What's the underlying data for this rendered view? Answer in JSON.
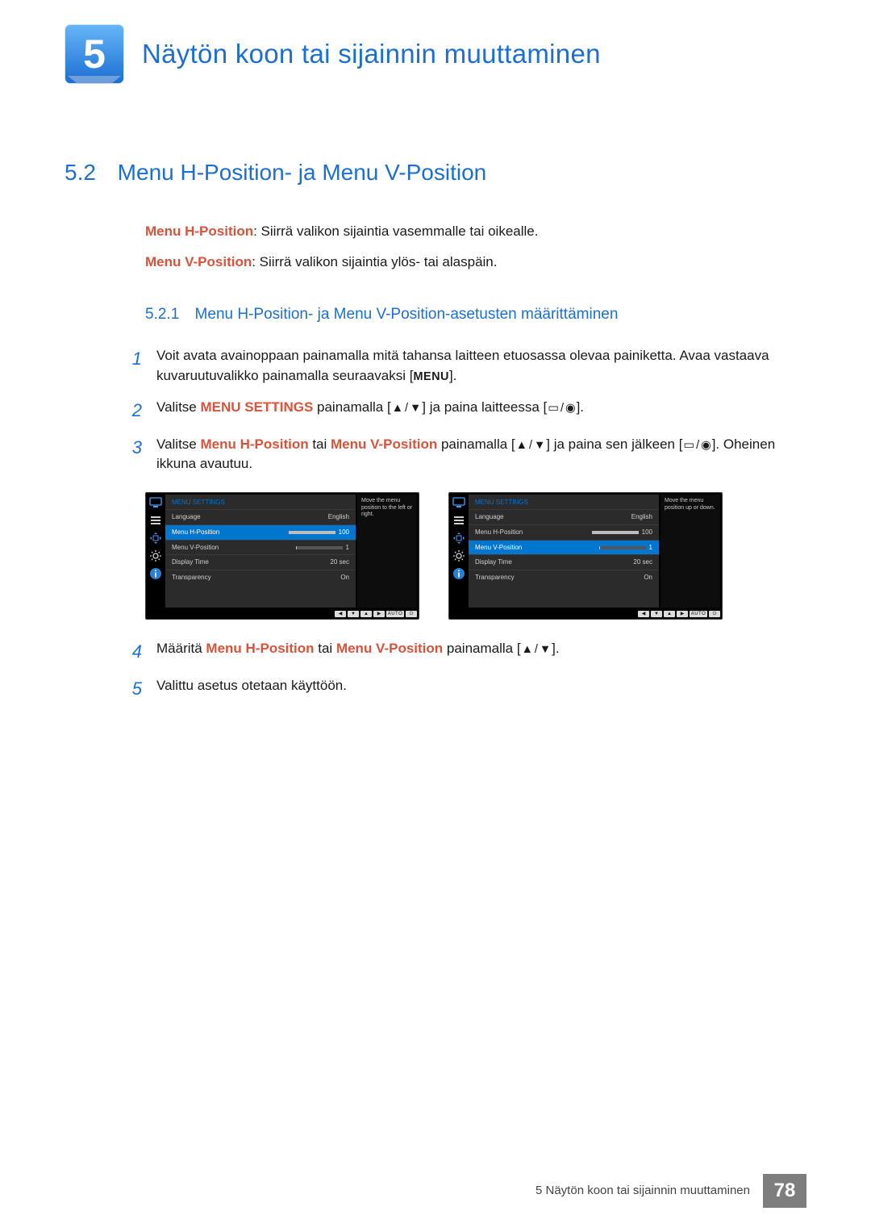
{
  "chapter": {
    "number": "5",
    "title": "Näytön koon tai sijainnin muuttaminen"
  },
  "section": {
    "number": "5.2",
    "title": "Menu H-Position- ja Menu V-Position"
  },
  "defs": {
    "h": {
      "term": "Menu H-Position",
      "text": ": Siirrä valikon sijaintia vasemmalle tai oikealle."
    },
    "v": {
      "term": "Menu V-Position",
      "text": ": Siirrä valikon sijaintia ylös- tai alaspäin."
    }
  },
  "subsection": {
    "number": "5.2.1",
    "title": "Menu H-Position- ja Menu V-Position-asetusten määrittäminen"
  },
  "steps": {
    "s1": {
      "n": "1",
      "a": "Voit avata avainoppaan painamalla mitä tahansa laitteen etuosassa olevaa painiketta. Avaa vastaava kuvaruutuvalikko painamalla seuraavaksi [",
      "menu": "MENU",
      "b": "]."
    },
    "s2": {
      "n": "2",
      "a": "Valitse ",
      "emph": "MENU SETTINGS",
      "b": " painamalla [",
      "c": "] ja paina laitteessa [",
      "d": "]."
    },
    "s3": {
      "n": "3",
      "a": "Valitse ",
      "h": "Menu H-Position",
      "mid": " tai ",
      "v": "Menu V-Position",
      "b": " painamalla [",
      "c": "] ja paina sen jälkeen [",
      "d": "]. Oheinen ikkuna avautuu."
    },
    "s4": {
      "n": "4",
      "a": "Määritä ",
      "h": "Menu H-Position",
      "mid": " tai ",
      "v": "Menu V-Position",
      "b": " painamalla [",
      "c": "]."
    },
    "s5": {
      "n": "5",
      "a": "Valittu asetus otetaan käyttöön."
    }
  },
  "osd": {
    "title": "MENU SETTINGS",
    "rows": {
      "language": {
        "label": "Language",
        "value": "English"
      },
      "hpos": {
        "label": "Menu H-Position",
        "value": "100"
      },
      "vpos": {
        "label": "Menu V-Position",
        "value": "1"
      },
      "display_time": {
        "label": "Display Time",
        "value": "20 sec"
      },
      "transparency": {
        "label": "Transparency",
        "value": "On"
      }
    },
    "tip_h": "Move the menu position to the left or right.",
    "tip_v": "Move the menu position up or down.",
    "buttons": {
      "left": "◀",
      "down": "▼",
      "up": "▲",
      "right": "▶",
      "auto": "AUTO",
      "power": "⏻"
    }
  },
  "footer": {
    "text": "5 Näytön koon tai sijainnin muuttaminen",
    "page": "78"
  }
}
